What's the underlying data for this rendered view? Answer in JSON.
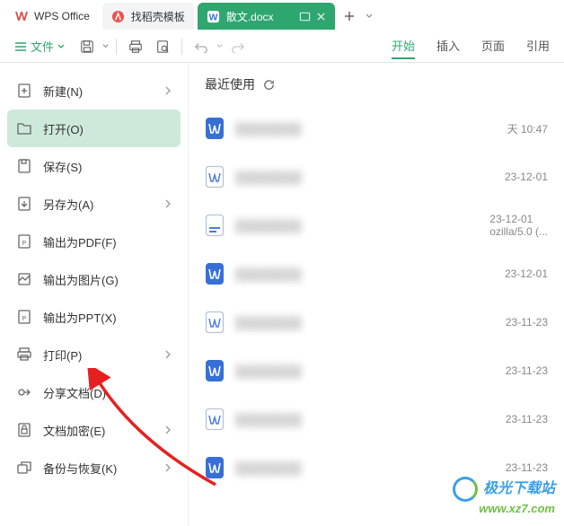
{
  "tabs": {
    "app_label": "WPS Office",
    "template_label": "找稻壳模板",
    "doc_label": "散文.docx"
  },
  "toolbar": {
    "file_label": "文件"
  },
  "ribbon": {
    "start": "开始",
    "insert": "插入",
    "page": "页面",
    "cite": "引用"
  },
  "sidebar": {
    "items": [
      {
        "label": "新建(N)",
        "has_sub": true
      },
      {
        "label": "打开(O)",
        "has_sub": false
      },
      {
        "label": "保存(S)",
        "has_sub": false
      },
      {
        "label": "另存为(A)",
        "has_sub": true
      },
      {
        "label": "输出为PDF(F)",
        "has_sub": false
      },
      {
        "label": "输出为图片(G)",
        "has_sub": false
      },
      {
        "label": "输出为PPT(X)",
        "has_sub": false
      },
      {
        "label": "打印(P)",
        "has_sub": true
      },
      {
        "label": "分享文档(D)",
        "has_sub": false
      },
      {
        "label": "文档加密(E)",
        "has_sub": true
      },
      {
        "label": "备份与恢复(K)",
        "has_sub": true
      }
    ]
  },
  "content": {
    "recent_header": "最近使用",
    "files": [
      {
        "date": "天  10:47",
        "type": "w-blue"
      },
      {
        "date": "23-12-01",
        "type": "w-outline"
      },
      {
        "date": "23-12-01",
        "date2": "ozilla/5.0 (...",
        "type": "txt"
      },
      {
        "date": "23-12-01",
        "type": "w-blue"
      },
      {
        "date": "23-11-23",
        "type": "w-outline"
      },
      {
        "date": "23-11-23",
        "type": "w-blue"
      },
      {
        "date": "23-11-23",
        "type": "w-outline"
      },
      {
        "date": "23-11-23",
        "type": "w-blue"
      }
    ]
  },
  "watermark": {
    "line1": "极光下载站",
    "line2": "www.xz7.com"
  }
}
